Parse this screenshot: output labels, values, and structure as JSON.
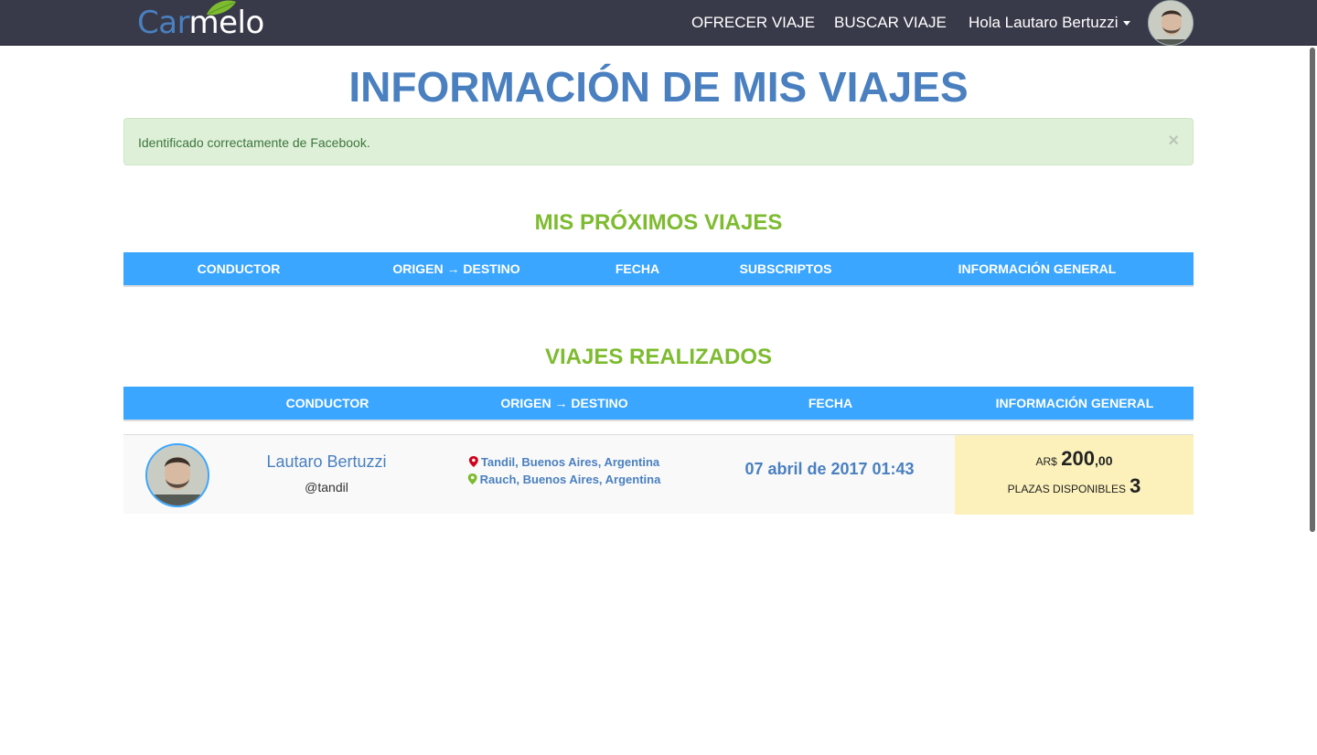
{
  "navbar": {
    "brand_part1": "Car",
    "brand_part2": "melo",
    "links": [
      {
        "label": "OFRECER VIAJE"
      },
      {
        "label": "BUSCAR VIAJE"
      },
      {
        "label": "Hola Lautaro Bertuzzi"
      }
    ],
    "icons": {
      "user_menu": "caret-down-icon",
      "avatar": "user-avatar"
    }
  },
  "page": {
    "title": "INFORMACIÓN DE MIS VIAJES"
  },
  "alert": {
    "message": "Identificado correctamente de Facebook.",
    "close_label": "×"
  },
  "upcoming": {
    "title": "MIS PRÓXIMOS VIAJES",
    "columns": [
      "CONDUCTOR",
      "ORIGEN → DESTINO",
      "FECHA",
      "SUBSCRIPTOS",
      "INFORMACIÓN GENERAL"
    ]
  },
  "completed": {
    "title": "VIAJES REALIZADOS",
    "columns": [
      "CONDUCTOR",
      "ORIGEN → DESTINO",
      "FECHA",
      "INFORMACIÓN GENERAL"
    ],
    "rows": [
      {
        "driver_name": "Lautaro Bertuzzi",
        "driver_handle": "@tandil",
        "origin": "Tandil, Buenos Aires, Argentina",
        "destination": "Rauch, Buenos Aires, Argentina",
        "date": "07 abril de 2017 01:43",
        "currency": "AR$",
        "price_integer": "200",
        "price_decimal": ",00",
        "seats_label": "PLAZAS DISPONIBLES",
        "seats_value": "3"
      }
    ]
  },
  "colors": {
    "navbar_bg": "#393a49",
    "brand_blue": "#4a80c0",
    "section_green": "#7dbb2f",
    "table_header_blue": "#3ba6ff",
    "alert_bg": "#dff0d8",
    "info_cell_bg": "#fcf1bb",
    "origin_pin": "#d0021b",
    "destination_pin": "#7dbb2f"
  }
}
